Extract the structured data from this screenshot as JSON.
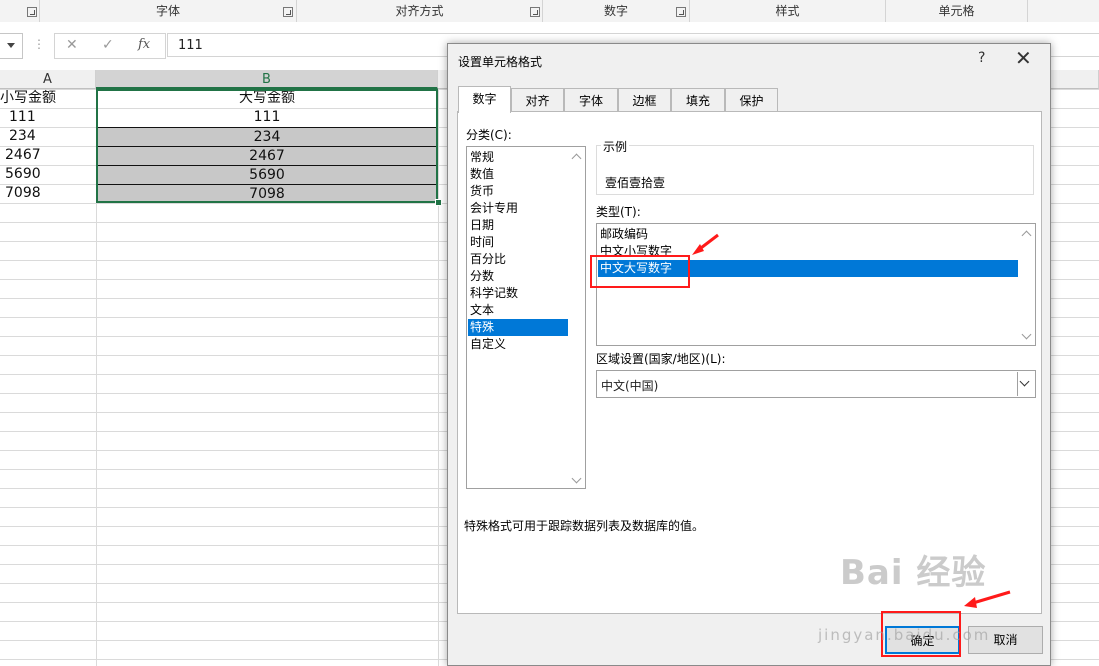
{
  "ribbon": {
    "groups": [
      "字体",
      "对齐方式",
      "数字",
      "样式",
      "单元格"
    ]
  },
  "formula_bar": {
    "cancel_icon": "cancel-icon",
    "enter_icon": "check-icon",
    "fx_label": "fx",
    "value": "111"
  },
  "sheet": {
    "columns": [
      "A",
      "B"
    ],
    "col_a": [
      "小写金额",
      "111",
      "234",
      "2467",
      "5690",
      "7098"
    ],
    "col_b": [
      "大写金额",
      "111",
      "234",
      "2467",
      "5690",
      "7098"
    ],
    "selection_color": "#217346"
  },
  "dialog": {
    "title": "设置单元格格式",
    "help": "?",
    "close": "✕",
    "tabs": [
      "数字",
      "对齐",
      "字体",
      "边框",
      "填充",
      "保护"
    ],
    "active_tab": "数字",
    "category_label": "分类(C):",
    "categories": [
      "常规",
      "数值",
      "货币",
      "会计专用",
      "日期",
      "时间",
      "百分比",
      "分数",
      "科学记数",
      "文本",
      "特殊",
      "自定义"
    ],
    "selected_category": "特殊",
    "sample_label": "示例",
    "sample_value": "壹佰壹拾壹",
    "type_label": "类型(T):",
    "types": [
      "邮政编码",
      "中文小写数字",
      "中文大写数字"
    ],
    "selected_type": "中文大写数字",
    "locale_label": "区域设置(国家/地区)(L):",
    "locale_value": "中文(中国)",
    "description": "特殊格式可用于跟踪数据列表及数据库的值。",
    "ok": "确定",
    "cancel": "取消",
    "accent": "#0078d7"
  },
  "watermark": {
    "brand": "Bai 经验",
    "url": "jingyan.baidu.com"
  }
}
